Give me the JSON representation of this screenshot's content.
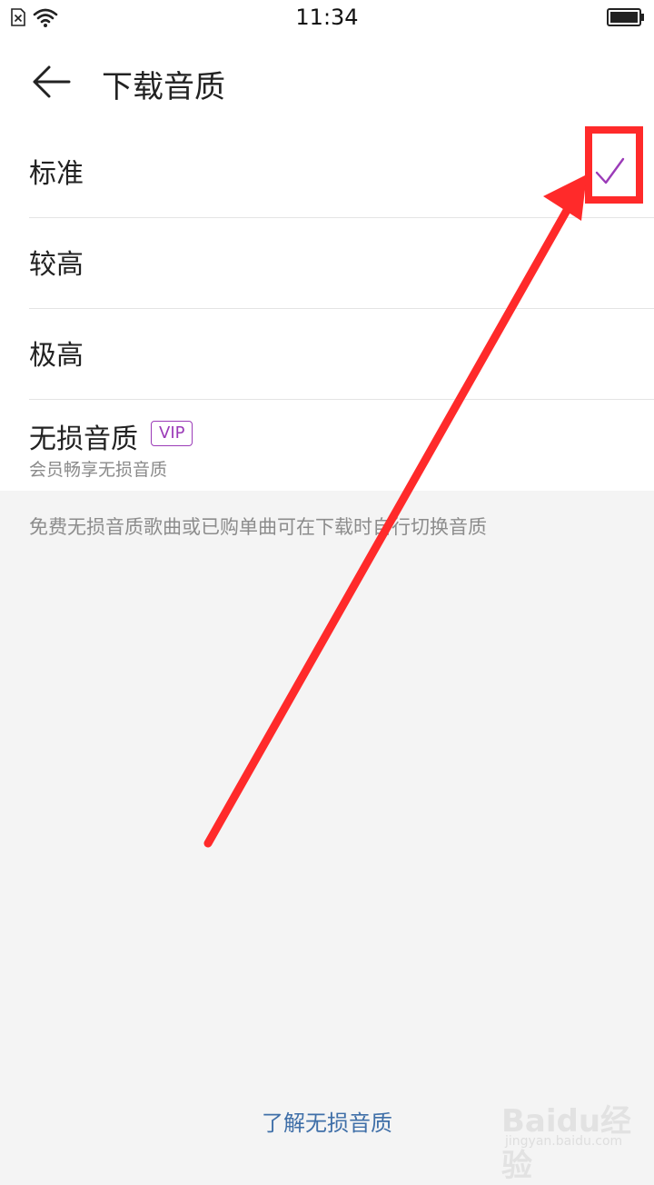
{
  "status_bar": {
    "time": "11:34",
    "icons": [
      "sim-error-icon",
      "wifi-icon",
      "battery-icon"
    ]
  },
  "header": {
    "back_icon": "arrow-left-icon",
    "title": "下载音质"
  },
  "quality_options": [
    {
      "label": "标准",
      "selected": true
    },
    {
      "label": "较高",
      "selected": false
    },
    {
      "label": "极高",
      "selected": false
    }
  ],
  "lossless": {
    "label": "无损音质",
    "badge": "VIP",
    "subtitle": "会员畅享无损音质"
  },
  "hint": "免费无损音质歌曲或已购单曲可在下载时自行切换音质",
  "learn_link": "了解无损音质",
  "watermark": {
    "logo": "Baidu经验",
    "url": "jingyan.baidu.com"
  },
  "colors": {
    "accent_purple": "#9b3bb8",
    "link_blue": "#3f6fa8",
    "annotation_red": "#ff2a2a",
    "background_gray": "#f4f4f4"
  }
}
